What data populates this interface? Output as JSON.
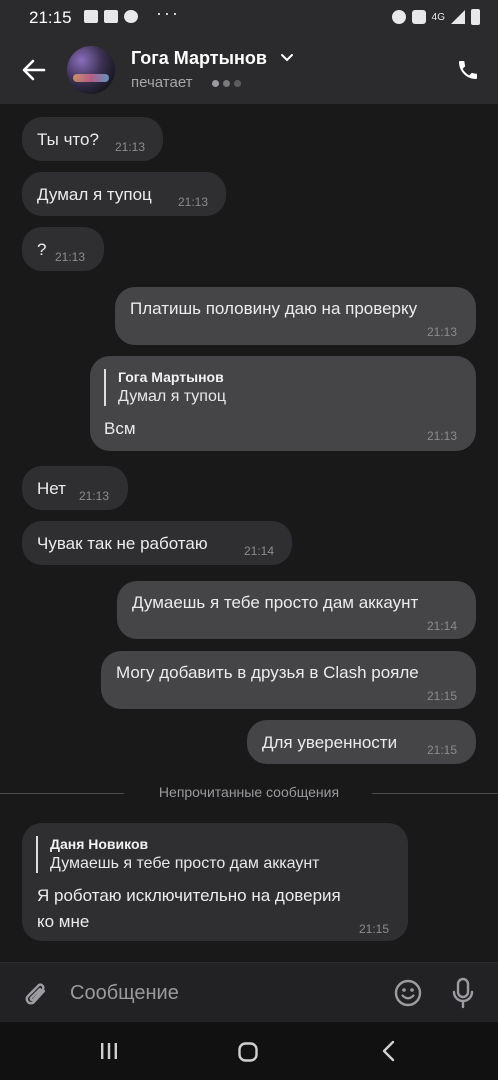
{
  "status_bar": {
    "time": "21:15",
    "network": "4G"
  },
  "header": {
    "name": "Гога Мартынов",
    "status": "печатает"
  },
  "messages": [
    {
      "text": "Ты что?",
      "time": "21:13"
    },
    {
      "text": "Думал я тупоц",
      "time": "21:13"
    },
    {
      "text": "?",
      "time": "21:13"
    },
    {
      "text": "Платишь половину даю на проверку",
      "time": "21:13"
    },
    {
      "reply_name": "Гога Мартынов",
      "reply_text": "Думал я тупоц",
      "text": "Всм",
      "time": "21:13"
    },
    {
      "text": "Нет",
      "time": "21:13"
    },
    {
      "text": "Чувак так не работаю",
      "time": "21:14"
    },
    {
      "text": "Думаешь я тебе просто дам аккаунт",
      "time": "21:14"
    },
    {
      "text": "Могу добавить в друзья в Clash рояле",
      "time": "21:15"
    },
    {
      "text": "Для уверенности",
      "time": "21:15"
    },
    {
      "reply_name": "Даня Новиков",
      "reply_text": "Думаешь я тебе просто дам аккаунт",
      "text_line1": "Я роботаю исключительно на доверия",
      "text_line2": "ко мне",
      "time": "21:15"
    }
  ],
  "unread_separator": "Непрочитанные сообщения",
  "composer": {
    "placeholder": "Сообщение"
  },
  "colors": {
    "background": "#19191a",
    "incoming_bubble": "#2f2f31",
    "outgoing_bubble": "#454547",
    "header": "#2b2b2d"
  }
}
